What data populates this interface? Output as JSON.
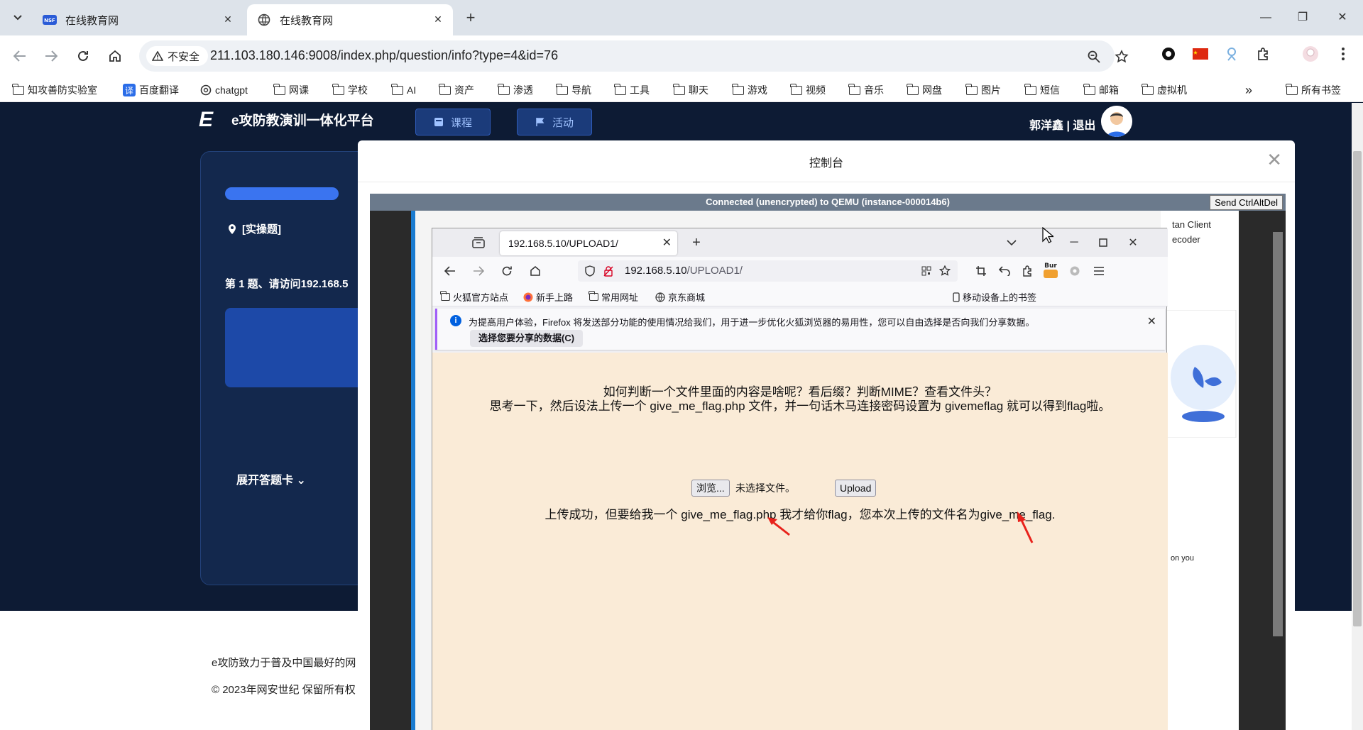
{
  "chrome": {
    "tabs": [
      {
        "title": "在线教育网",
        "favicon": "nsf-logo-icon"
      },
      {
        "title": "在线教育网",
        "favicon": "globe-icon"
      }
    ],
    "security_label": "不安全",
    "url_host": "211.103.180.146",
    "url_rest": ":9008/index.php/question/info?type=4&id=76",
    "bookmarks": [
      "知攻善防实验室",
      "百度翻译",
      "chatgpt",
      "网课",
      "学校",
      "AI",
      "资产",
      "渗透",
      "导航",
      "工具",
      "聊天",
      "游戏",
      "视频",
      "音乐",
      "网盘",
      "图片",
      "短信",
      "邮箱",
      "虚拟机"
    ],
    "all_bookmarks": "所有书签"
  },
  "site": {
    "logo_text": "e攻防教演训一体化平台",
    "nav_course": "课程",
    "nav_activity": "活动",
    "user_text": "郭洋鑫 | 退出",
    "question_type": "[实操题]",
    "question_text": "第 1 题、请访问192.168.5",
    "expand_card": "展开答题卡",
    "footer_line1": "e攻防致力于普及中国最好的网",
    "footer_line2": "© 2023年网安世纪 保留所有权"
  },
  "modal": {
    "title": "控制台",
    "vnc_status": "Connected (unencrypted) to QEMU (instance-000014b6)",
    "send_cad": "Send CtrlAltDel"
  },
  "remote": {
    "side_text1": "tan Client",
    "side_text2": "ecoder",
    "side_text3": "on you"
  },
  "firefox": {
    "tab_title": "192.168.5.10/UPLOAD1/",
    "url_host": "192.168.5.10",
    "url_path": "/UPLOAD1/",
    "bookmarks": [
      "火狐官方站点",
      "新手上路",
      "常用网址",
      "京东商城"
    ],
    "mobile_bookmarks": "移动设备上的书签",
    "notice_text": "为提高用户体验，Firefox 将发送部分功能的使用情况给我们，用于进一步优化火狐浏览器的易用性，您可以自由选择是否向我们分享数据。",
    "notice_button": "选择您要分享的数据(C)",
    "burp_label": "Bur"
  },
  "upload_page": {
    "line1": "如何判断一个文件里面的内容是啥呢？看后缀？判断MIME？查看文件头？",
    "line2": "思考一下，然后设法上传一个 give_me_flag.php 文件，并一句话木马连接密码设置为 givemeflag 就可以得到flag啦。",
    "browse_button": "浏览...",
    "no_file": "未选择文件。",
    "upload_button": "Upload",
    "result": "上传成功，但要给我一个 give_me_flag.php 我才给你flag，您本次上传的文件名为give_me_flag."
  },
  "colors": {
    "page_bg": "#0d1b34",
    "upload_bg": "#faebd7",
    "annotation_arrow": "#e8221b",
    "progress": "#3a74f0"
  }
}
